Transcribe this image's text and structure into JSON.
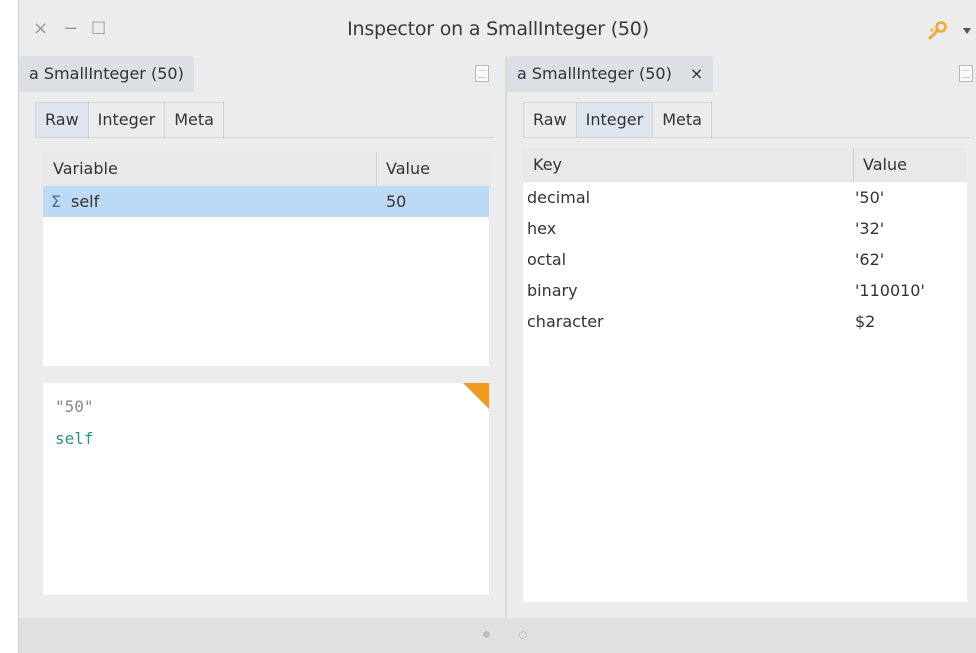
{
  "window": {
    "title": "Inspector on a SmallInteger (50)",
    "close_glyph": "×",
    "minimize_glyph": "−",
    "maximize_glyph": "☐"
  },
  "left_pane": {
    "object_tab": "a SmallInteger (50)",
    "subtabs": [
      "Raw",
      "Integer",
      "Meta"
    ],
    "active_subtab": "Raw",
    "table": {
      "headers": [
        "Variable",
        "Value"
      ],
      "rows": [
        {
          "icon": "Σ",
          "variable": "self",
          "value": "50",
          "selected": true
        }
      ]
    },
    "code": {
      "comment": "\"50\"",
      "expression": "self"
    }
  },
  "right_pane": {
    "object_tab": "a SmallInteger (50)",
    "close_glyph": "×",
    "subtabs": [
      "Raw",
      "Integer",
      "Meta"
    ],
    "active_subtab": "Integer",
    "table": {
      "headers": [
        "Key",
        "Value"
      ],
      "rows": [
        {
          "key": "decimal",
          "value": "'50'"
        },
        {
          "key": "hex",
          "value": "'32'"
        },
        {
          "key": "octal",
          "value": "'62'"
        },
        {
          "key": "binary",
          "value": "'110010'"
        },
        {
          "key": "character",
          "value": "$2"
        }
      ]
    }
  },
  "colors": {
    "selection": "#bcd9f5",
    "active_tab": "#dfe5ee",
    "corner_accent": "#f39a1e",
    "code_comment": "#8a8a8a",
    "code_keyword": "#2f8f8f"
  },
  "statusbar": {
    "pager_pages": 2,
    "pager_current": 1
  }
}
